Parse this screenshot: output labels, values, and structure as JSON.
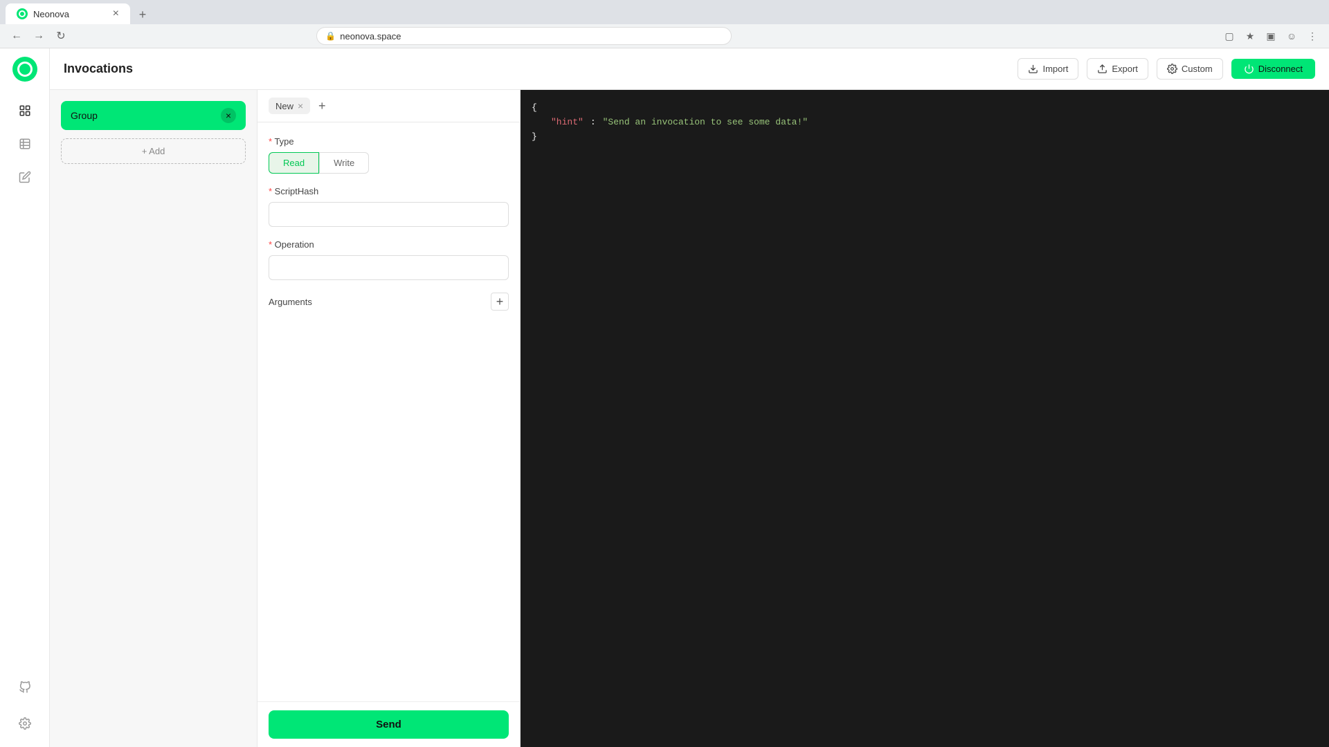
{
  "browser": {
    "tab_title": "Neonova",
    "url": "neonova.space",
    "new_tab_label": "+"
  },
  "header": {
    "title": "Invocations",
    "import_label": "Import",
    "export_label": "Export",
    "custom_label": "Custom",
    "disconnect_label": "Disconnect"
  },
  "left_panel": {
    "group_name": "Group",
    "add_label": "+ Add"
  },
  "tabs": [
    {
      "label": "New",
      "active": true
    }
  ],
  "form": {
    "type_label": "Type",
    "read_label": "Read",
    "write_label": "Write",
    "script_hash_label": "ScriptHash",
    "script_hash_placeholder": "",
    "operation_label": "Operation",
    "operation_placeholder": "",
    "arguments_label": "Arguments",
    "send_label": "Send"
  },
  "json_output": {
    "line1": "{",
    "key1": "hint",
    "value1": "\"Send an invocation to see some data!\"",
    "line_end": "}"
  },
  "colors": {
    "accent": "#00e676",
    "dark_bg": "#1a1a1a"
  }
}
